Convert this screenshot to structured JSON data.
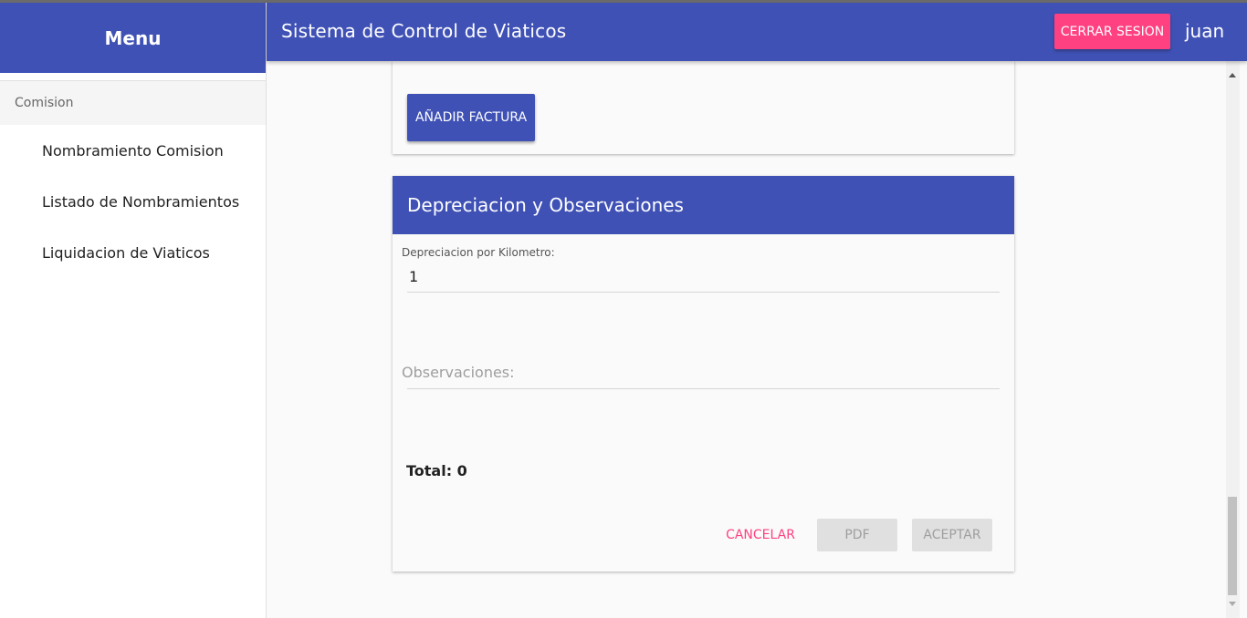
{
  "sidebar": {
    "title": "Menu",
    "section": "Comision",
    "items": [
      {
        "label": "Nombramiento Comision"
      },
      {
        "label": "Listado de Nombramientos"
      },
      {
        "label": "Liquidacion de Viaticos"
      }
    ]
  },
  "topbar": {
    "title": "Sistema de Control de Viaticos",
    "logout_label": "CERRAR SESION",
    "user": "juan"
  },
  "invoice_card": {
    "add_invoice_label": "AÑADIR FACTURA"
  },
  "depreciation_card": {
    "title": "Depreciacion y Observaciones",
    "km_label": "Depreciacion por Kilometro:",
    "km_value": "1",
    "observations_label": "Observaciones:",
    "observations_value": "",
    "total_text": "Total: 0",
    "cancel_label": "CANCELAR",
    "pdf_label": "PDF",
    "accept_label": "ACEPTAR"
  },
  "colors": {
    "primary": "#3f51b5",
    "accent": "#ff4081",
    "disabled": "#e0e0e0"
  }
}
